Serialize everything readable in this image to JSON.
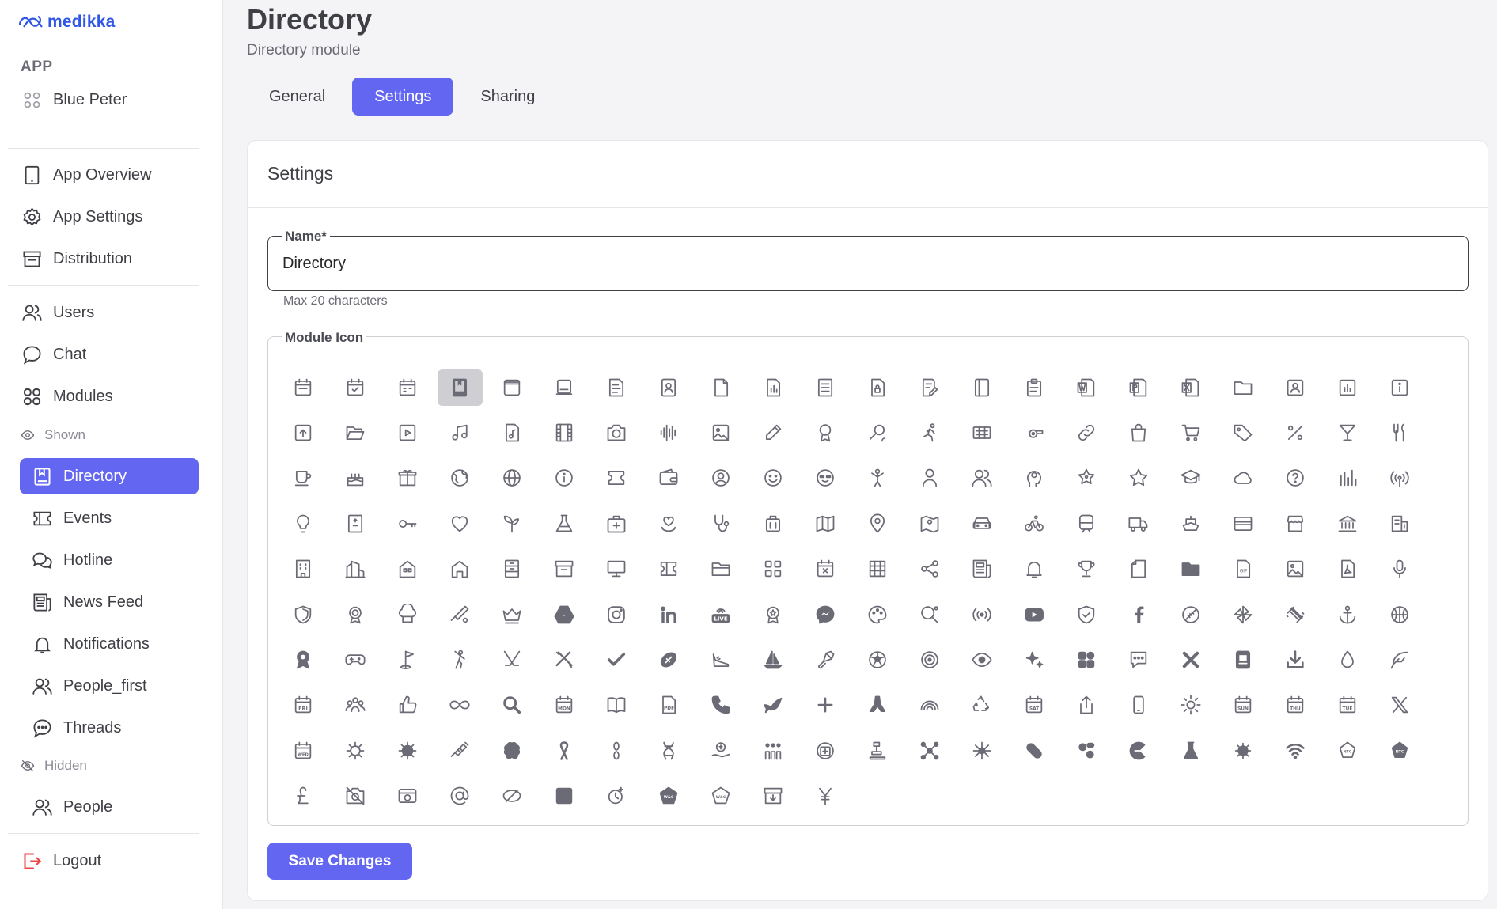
{
  "brand": {
    "name": "medikka",
    "color": "#2f56e6"
  },
  "sidebar": {
    "section_label": "APP",
    "app_name": "Blue Peter",
    "app_links": [
      {
        "label": "App Overview",
        "icon": "tablet-icon"
      },
      {
        "label": "App Settings",
        "icon": "gear-icon"
      },
      {
        "label": "Distribution",
        "icon": "archive-icon"
      }
    ],
    "main_links": [
      {
        "label": "Users",
        "icon": "users-icon"
      },
      {
        "label": "Chat",
        "icon": "chat-bubble-icon"
      },
      {
        "label": "Modules",
        "icon": "grid-icon"
      }
    ],
    "shown_label": "Shown",
    "shown_modules": [
      {
        "label": "Directory",
        "icon": "book-icon",
        "active": true
      },
      {
        "label": "Events",
        "icon": "ticket-icon"
      },
      {
        "label": "Hotline",
        "icon": "chats-icon"
      },
      {
        "label": "News Feed",
        "icon": "newspaper-icon"
      },
      {
        "label": "Notifications",
        "icon": "bell-icon"
      },
      {
        "label": "People_first",
        "icon": "users-icon"
      },
      {
        "label": "Threads",
        "icon": "chat-dots-icon"
      }
    ],
    "hidden_label": "Hidden",
    "hidden_modules": [
      {
        "label": "People",
        "icon": "users-icon"
      }
    ],
    "logout_label": "Logout"
  },
  "header": {
    "title": "Directory",
    "subtitle": "Directory module"
  },
  "tabs": [
    {
      "label": "General",
      "active": false
    },
    {
      "label": "Settings",
      "active": true
    },
    {
      "label": "Sharing",
      "active": false
    }
  ],
  "settings": {
    "card_title": "Settings",
    "name_label": "Name*",
    "name_value": "Directory",
    "name_helper": "Max 20 characters",
    "icon_label": "Module Icon",
    "save_label": "Save Changes"
  },
  "colors": {
    "accent": "#6366f1",
    "icon": "#6b6b76",
    "logout": "#ef4444"
  },
  "icons": [
    "calendar",
    "calendar-check",
    "calendar-grid",
    "book-bookmark",
    "browser",
    "laptop",
    "doc-text",
    "id-card",
    "file",
    "file-chart",
    "doc-lines",
    "file-lock",
    "file-edit",
    "notebook",
    "clipboard",
    "word-file",
    "powerpoint-file",
    "excel-file",
    "folder",
    "contacts",
    "chart-box",
    "info-box",
    "file-upload",
    "folder-open",
    "play-box",
    "music-note",
    "music-file",
    "film",
    "camera",
    "soundwave",
    "image",
    "pencil",
    "award",
    "search-person",
    "running-person",
    "keyboard",
    "whistle",
    "link",
    "shopping-bag",
    "cart",
    "tag",
    "percent",
    "cocktail",
    "fork-knife",
    "coffee-cup",
    "cake",
    "gift",
    "earth",
    "globe",
    "info-circle",
    "ticket",
    "wallet",
    "user-circle",
    "smile",
    "face-cool",
    "yoga",
    "person",
    "people",
    "head-idea",
    "star-badge",
    "star",
    "graduation",
    "cloud",
    "question-circle",
    "bars-chart",
    "broadcast",
    "lightbulb",
    "door",
    "key",
    "heart",
    "sprout",
    "flask",
    "first-aid",
    "heart-pin",
    "stethoscope",
    "luggage",
    "map",
    "map-pin",
    "map-person",
    "car",
    "bicycle",
    "train",
    "truck",
    "ship",
    "card-holder",
    "store",
    "bank",
    "building-chart",
    "office",
    "city",
    "apartment",
    "house",
    "cabinet",
    "archive-box",
    "monitor",
    "ticket-alt",
    "folder-alt",
    "apps",
    "calendar-x",
    "table",
    "share",
    "newspaper",
    "bell",
    "trophy",
    "page",
    "folder-solid",
    "gif-file",
    "image-file",
    "pdf-file",
    "microphone",
    "shield",
    "medal",
    "chef",
    "cricket",
    "crown",
    "google-drive",
    "instagram",
    "linkedin",
    "live",
    "rosette",
    "messenger",
    "palette",
    "tennis",
    "podcast",
    "youtube",
    "shield-check",
    "facebook",
    "rugby",
    "pinwheel",
    "dumbbell",
    "anchor",
    "basketball",
    "medal-solid",
    "gamepad",
    "golf-flag",
    "golfer",
    "hockey",
    "badminton-x",
    "checkmark",
    "rugby-ball",
    "shoe",
    "sailboat",
    "shuttlecock",
    "soccer",
    "target",
    "eye",
    "sparkles",
    "widgets",
    "comment-dots",
    "x-mark",
    "id-badge",
    "download",
    "water-drop",
    "feather",
    "friday",
    "team",
    "thumbs-up",
    "infinity",
    "magnifier",
    "monday",
    "open-book",
    "pdf",
    "phone",
    "dove",
    "plus",
    "praying-hands",
    "rainbow",
    "recycle",
    "saturday",
    "share-up",
    "smartphone",
    "sun",
    "sunday",
    "thursday",
    "tuesday",
    "x-logo",
    "wednesday",
    "virus",
    "covid",
    "syringe",
    "brain",
    "ribbon",
    "chromosome",
    "dna",
    "donate",
    "crowd",
    "medical-kit",
    "scale",
    "molecule",
    "neuron",
    "pill",
    "pills",
    "pacman",
    "test-tube",
    "sars",
    "wifi",
    "ntc-outline",
    "ntc-solid",
    "pound",
    "no-camera",
    "camera-alt",
    "at-sign",
    "eye-slash",
    "square",
    "timer-plus",
    "wac-solid",
    "wac-outline",
    "archive-down",
    "yen"
  ]
}
